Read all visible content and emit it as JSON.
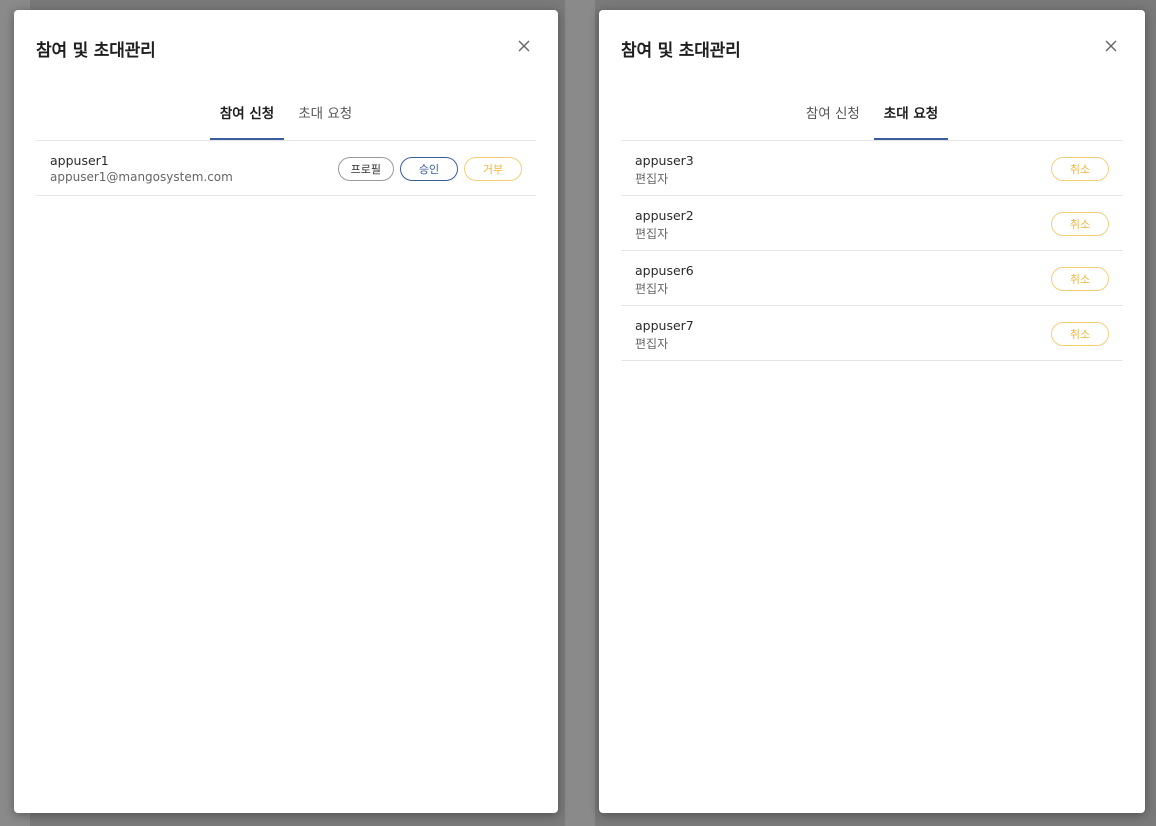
{
  "left_modal": {
    "title": "참여 및 초대관리",
    "tabs": [
      {
        "label": "참여 신청",
        "active": true
      },
      {
        "label": "초대 요청",
        "active": false
      }
    ],
    "rows": [
      {
        "name": "appuser1",
        "sub": "appuser1@mangosystem.com",
        "actions": {
          "profile": "프로필",
          "approve": "승인",
          "reject": "거부"
        }
      }
    ]
  },
  "right_modal": {
    "title": "참여 및 초대관리",
    "tabs": [
      {
        "label": "참여 신청",
        "active": false
      },
      {
        "label": "초대 요청",
        "active": true
      }
    ],
    "rows": [
      {
        "name": "appuser3",
        "sub": "편집자",
        "action": "취소"
      },
      {
        "name": "appuser2",
        "sub": "편집자",
        "action": "취소"
      },
      {
        "name": "appuser6",
        "sub": "편집자",
        "action": "취소"
      },
      {
        "name": "appuser7",
        "sub": "편집자",
        "action": "취소"
      }
    ]
  },
  "colors": {
    "accent_blue": "#3c5c9b",
    "reject_orange": "#f0b53a",
    "divider": "#e6e6e6",
    "overlay": "#7a7a7a"
  },
  "icons": {
    "close": "close-icon"
  }
}
